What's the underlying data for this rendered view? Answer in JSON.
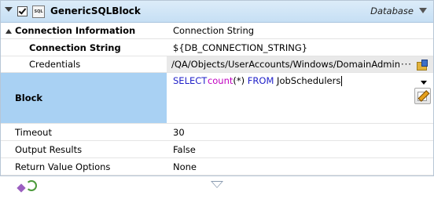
{
  "activity": {
    "title": "GenericSQLBlock",
    "category": "Database",
    "icon": "sql-icon"
  },
  "group": {
    "label": "Connection Information",
    "value": "Connection String"
  },
  "properties": [
    {
      "key": "connection_string",
      "label": "Connection String",
      "value": "${DB_CONNECTION_STRING}"
    },
    {
      "key": "credentials",
      "label": "Credentials",
      "value": "/QA/Objects/UserAccounts/Windows/DomainAdmini",
      "ellipsis": "···"
    }
  ],
  "block": {
    "label": "Block",
    "sql": {
      "kw1": "SELECT",
      "fn": "count",
      "args": "(*)",
      "kw2": "FROM",
      "table": "JobSchedulers"
    }
  },
  "other_properties": [
    {
      "key": "timeout",
      "label": "Timeout",
      "value": "30"
    },
    {
      "key": "output_results",
      "label": "Output Results",
      "value": "False"
    },
    {
      "key": "return_value_options",
      "label": "Return Value Options",
      "value": "None"
    }
  ],
  "colors": {
    "titlebar": "#c6dff4",
    "selected_row": "#a9d1f3",
    "keyword": "#1f1fc8",
    "function": "#c000c0"
  }
}
